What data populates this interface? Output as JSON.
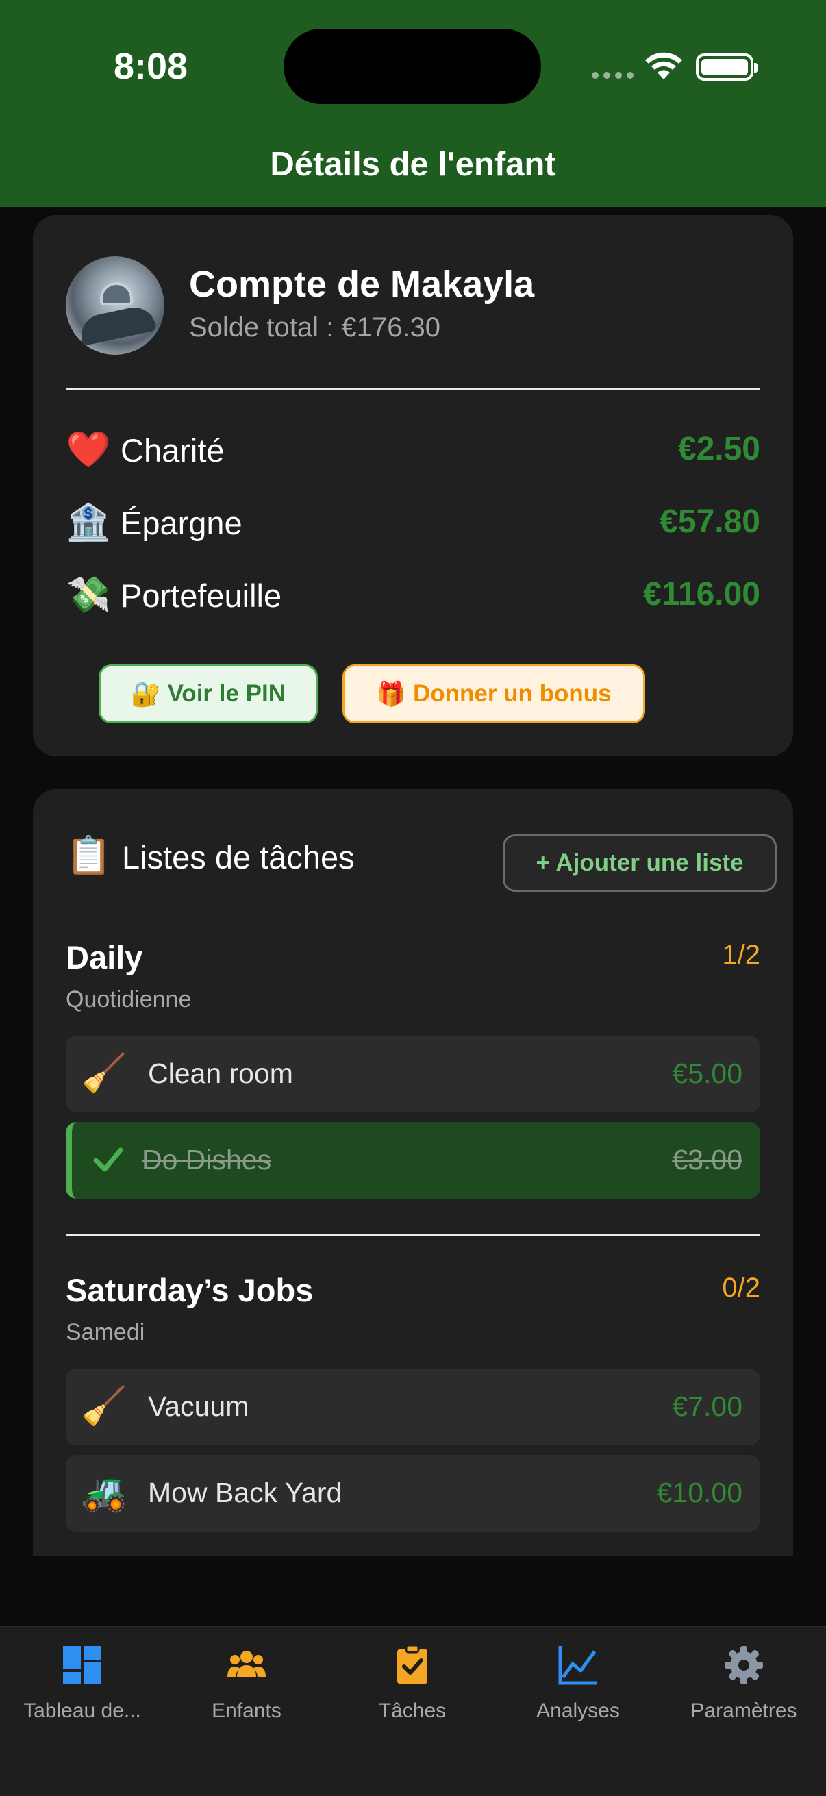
{
  "status_bar": {
    "time": "8:08"
  },
  "header": {
    "title": "Détails de l'enfant"
  },
  "account": {
    "name": "Compte de Makayla",
    "total_balance": "Solde total : €176.30",
    "buckets": [
      {
        "icon": "❤️",
        "label": "Charité",
        "amount": "€2.50"
      },
      {
        "icon": "🏦",
        "label": "Épargne",
        "amount": "€57.80"
      },
      {
        "icon": "💸",
        "label": "Portefeuille",
        "amount": "€116.00"
      }
    ],
    "pin_button": {
      "icon": "🔐",
      "label": "Voir le PIN"
    },
    "bonus_button": {
      "icon": "🎁",
      "label": "Donner un bonus"
    }
  },
  "tasks": {
    "icon": "📋",
    "title": "Listes de tâches",
    "add_button": "+ Ajouter une liste",
    "lists": [
      {
        "name": "Daily",
        "frequency": "Quotidienne",
        "progress": "1/2",
        "items": [
          {
            "icon": "🧹",
            "name": "Clean room",
            "amount": "€5.00",
            "done": false
          },
          {
            "icon": "✓",
            "name": "Do Dishes",
            "amount": "€3.00",
            "done": true
          }
        ]
      },
      {
        "name": "Saturday’s Jobs",
        "frequency": "Samedi",
        "progress": "0/2",
        "items": [
          {
            "icon": "🧹",
            "name": "Vacuum",
            "amount": "€7.00",
            "done": false
          },
          {
            "icon": "🚜",
            "name": "Mow Back Yard",
            "amount": "€10.00",
            "done": false
          }
        ]
      }
    ]
  },
  "tabbar": {
    "tabs": [
      {
        "label": "Tableau de...",
        "icon": "dashboard-icon",
        "color": "#2f8ff0"
      },
      {
        "label": "Enfants",
        "icon": "people-icon",
        "color": "#f5a623"
      },
      {
        "label": "Tâches",
        "icon": "clipboard-check-icon",
        "color": "#f5a623"
      },
      {
        "label": "Analyses",
        "icon": "line-chart-icon",
        "color": "#2f8ff0"
      },
      {
        "label": "Paramètres",
        "icon": "gear-icon",
        "color": "#8a96a3"
      }
    ]
  },
  "colors": {
    "header_bg": "#1e5c1f",
    "card_bg": "#202020",
    "money_green": "#2f8a34",
    "accent_orange": "#f5a623"
  }
}
